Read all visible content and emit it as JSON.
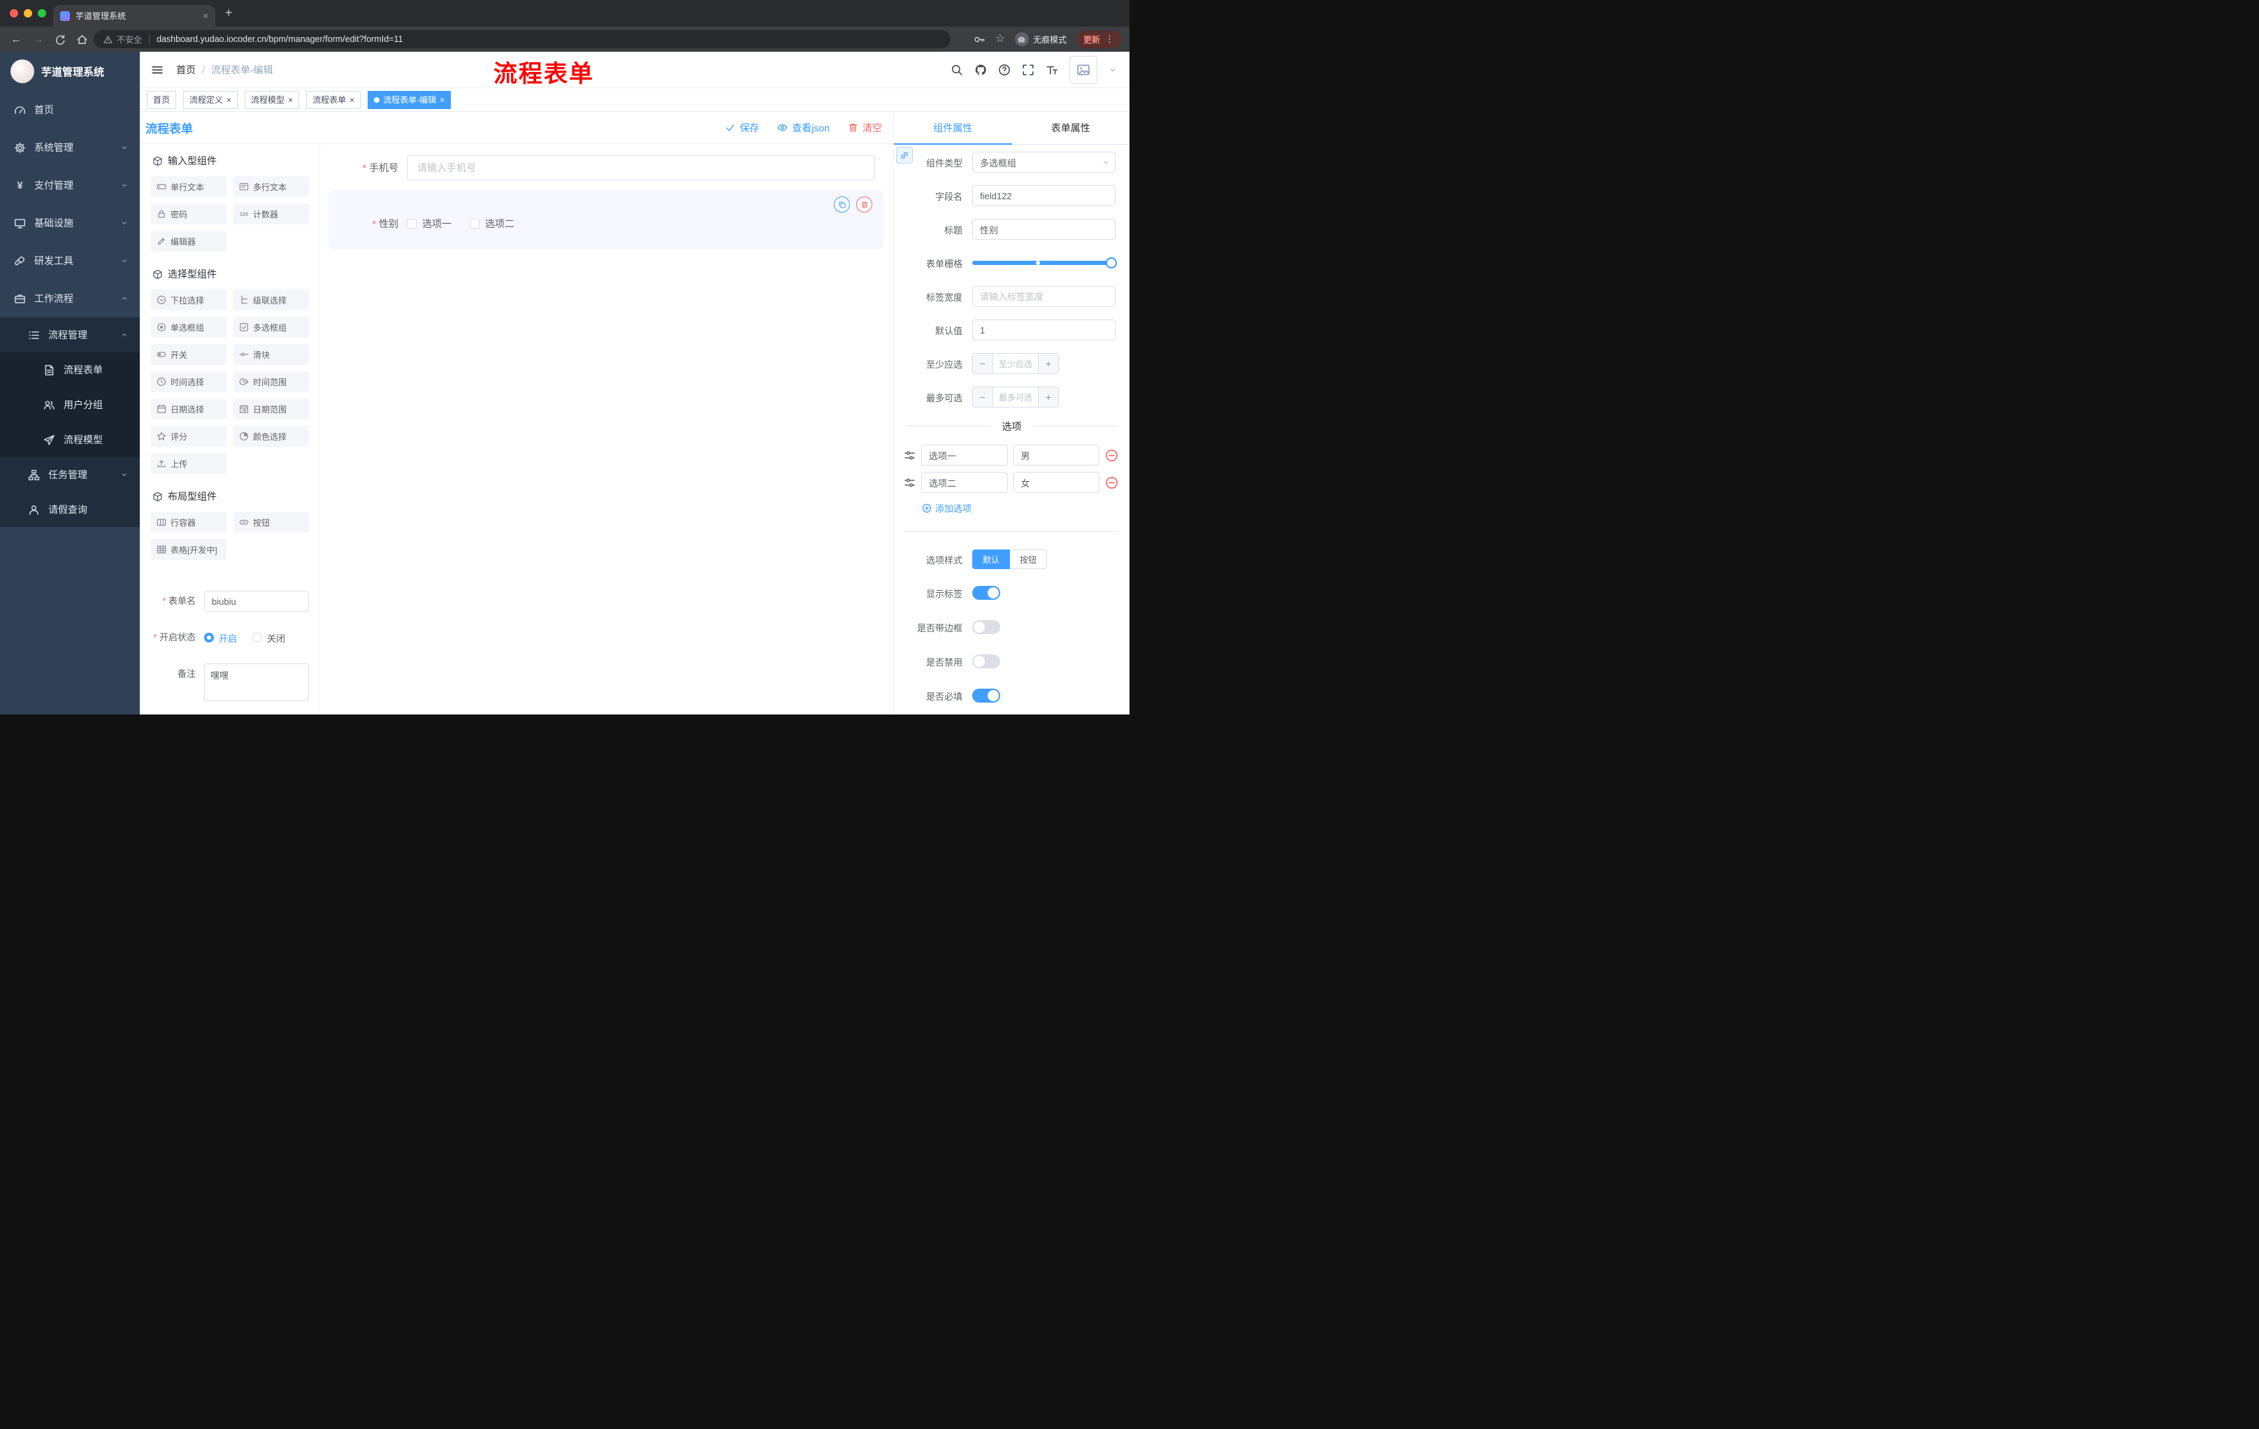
{
  "colors": {
    "primary": "#409eff",
    "danger": "#f56c6c",
    "annotation_red": "#fe0100",
    "sidebar_bg": "#304156",
    "sidebar_sub_bg": "#1f2d3d",
    "active_block_bg": "#f6f7ff"
  },
  "browser": {
    "tab": {
      "title": "芋道管理系统",
      "favicon": "yudao-logo-icon",
      "close_icon": "close-icon"
    },
    "nav": {
      "security_label": "不安全",
      "url": "dashboard.yudao.iocoder.cn/bpm/manager/form/edit?formId=11",
      "incognito_label": "无痕模式",
      "update_label": "更新",
      "icons": [
        "back-icon",
        "forward-icon",
        "reload-icon",
        "home-icon",
        "warning-icon",
        "key-icon",
        "star-icon",
        "incognito-icon",
        "more-icon"
      ]
    }
  },
  "sidebar": {
    "logo_title": "芋道管理系统",
    "items": [
      {
        "label": "首页",
        "icon": "dashboard-icon",
        "depth": 1
      },
      {
        "label": "系统管理",
        "icon": "gear-icon",
        "depth": 1,
        "expandable": true
      },
      {
        "label": "支付管理",
        "icon": "yen-icon",
        "depth": 1,
        "expandable": true
      },
      {
        "label": "基础设施",
        "icon": "monitor-icon",
        "depth": 1,
        "expandable": true
      },
      {
        "label": "研发工具",
        "icon": "wrench-icon",
        "depth": 1,
        "expandable": true
      },
      {
        "label": "工作流程",
        "icon": "briefcase-icon",
        "depth": 1,
        "expandable": true,
        "expanded": true
      },
      {
        "label": "流程管理",
        "icon": "list-icon",
        "depth": 2,
        "expandable": true,
        "expanded": true
      },
      {
        "label": "流程表单",
        "icon": "document-icon",
        "depth": 3
      },
      {
        "label": "用户分组",
        "icon": "users-icon",
        "depth": 3
      },
      {
        "label": "流程模型",
        "icon": "paper-plane-icon",
        "depth": 3
      },
      {
        "label": "任务管理",
        "icon": "tree-icon",
        "depth": 2,
        "expandable": true
      },
      {
        "label": "请假查询",
        "icon": "person-icon",
        "depth": 2
      }
    ]
  },
  "app_header": {
    "breadcrumb": {
      "home": "首页",
      "separator": "/",
      "current": "流程表单-编辑"
    },
    "annotation": "流程表单",
    "right_icons": [
      "search-icon",
      "github-icon",
      "help-icon",
      "fullscreen-icon",
      "font-size-icon",
      "avatar",
      "chevron-down-icon"
    ]
  },
  "tags_view": {
    "tags": [
      {
        "label": "首页",
        "closable": false,
        "active": false
      },
      {
        "label": "流程定义",
        "closable": true,
        "active": false
      },
      {
        "label": "流程模型",
        "closable": true,
        "active": false
      },
      {
        "label": "流程表单",
        "closable": true,
        "active": false
      },
      {
        "label": "流程表单-编辑",
        "closable": true,
        "active": true
      }
    ]
  },
  "editor": {
    "title": "流程表单",
    "save_label": "保存",
    "view_json_label": "查看json",
    "clear_label": "清空"
  },
  "palette": {
    "sections": [
      {
        "title": "输入型组件",
        "items": [
          {
            "label": "单行文本",
            "icon": "single-line-text-icon"
          },
          {
            "label": "多行文本",
            "icon": "multi-line-text-icon"
          },
          {
            "label": "密码",
            "icon": "lock-icon"
          },
          {
            "label": "计数器",
            "icon": "counter-icon"
          },
          {
            "label": "编辑器",
            "icon": "editor-icon"
          }
        ]
      },
      {
        "title": "选择型组件",
        "items": [
          {
            "label": "下拉选择",
            "icon": "select-icon"
          },
          {
            "label": "级联选择",
            "icon": "cascader-icon"
          },
          {
            "label": "单选框组",
            "icon": "radio-icon"
          },
          {
            "label": "多选框组",
            "icon": "checkbox-icon"
          },
          {
            "label": "开关",
            "icon": "switch-icon"
          },
          {
            "label": "滑块",
            "icon": "slider-icon"
          },
          {
            "label": "时间选择",
            "icon": "time-icon"
          },
          {
            "label": "时间范围",
            "icon": "time-range-icon"
          },
          {
            "label": "日期选择",
            "icon": "date-icon"
          },
          {
            "label": "日期范围",
            "icon": "date-range-icon"
          },
          {
            "label": "评分",
            "icon": "star-icon"
          },
          {
            "label": "颜色选择",
            "icon": "color-icon"
          },
          {
            "label": "上传",
            "icon": "upload-icon"
          }
        ]
      },
      {
        "title": "布局型组件",
        "items": [
          {
            "label": "行容器",
            "icon": "row-container-icon"
          },
          {
            "label": "按钮",
            "icon": "button-icon"
          },
          {
            "label": "表格[开发中]",
            "icon": "table-icon"
          }
        ]
      }
    ]
  },
  "meta_form": {
    "form_name": {
      "label": "表单名",
      "value": "biubiu",
      "required": true
    },
    "status": {
      "label": "开启状态",
      "options": [
        "开启",
        "关闭"
      ],
      "selected": "开启",
      "required": true
    },
    "remark": {
      "label": "备注",
      "value": "嘿嘿"
    }
  },
  "canvas": {
    "phone_field": {
      "label": "手机号",
      "required": true,
      "placeholder": "请输入手机号"
    },
    "gender_field": {
      "label": "性别",
      "required": true,
      "options": [
        "选项一",
        "选项二"
      ],
      "selected_component": true
    }
  },
  "props_panel": {
    "tabs": [
      "组件属性",
      "表单属性"
    ],
    "active_tab": "组件属性",
    "component_type": {
      "label": "组件类型",
      "value": "多选框组"
    },
    "field_name": {
      "label": "字段名",
      "value": "field122"
    },
    "title": {
      "label": "标题",
      "value": "性别"
    },
    "form_grid": {
      "label": "表单栅格"
    },
    "label_width": {
      "label": "标签宽度",
      "placeholder": "请输入标签宽度"
    },
    "default_value": {
      "label": "默认值",
      "value": "1"
    },
    "min_select": {
      "label": "至少应选",
      "placeholder": "至少应选"
    },
    "max_select": {
      "label": "最多可选",
      "placeholder": "最多可选"
    },
    "options_divider": "选项",
    "options": [
      {
        "name": "选项一",
        "value": "男"
      },
      {
        "name": "选项二",
        "value": "女"
      }
    ],
    "add_option_label": "添加选项",
    "option_style": {
      "label": "选项样式",
      "options": [
        "默认",
        "按钮"
      ],
      "selected": "默认"
    },
    "switches": [
      {
        "label": "显示标签",
        "on": true
      },
      {
        "label": "是否带边框",
        "on": false
      },
      {
        "label": "是否禁用",
        "on": false
      },
      {
        "label": "是否必填",
        "on": true
      }
    ]
  }
}
